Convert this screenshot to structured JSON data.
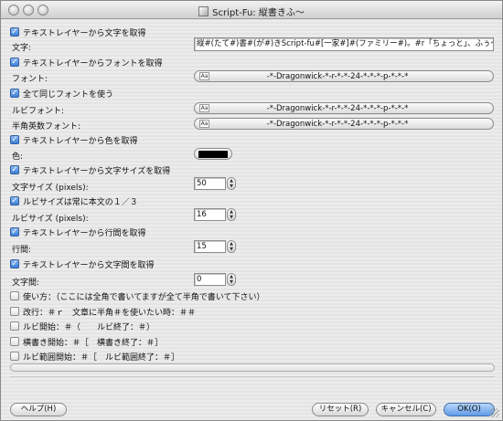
{
  "window": {
    "title": "Script-Fu: 縦書きふ〜"
  },
  "options": {
    "get_text_from_layer": {
      "label": "テキストレイヤーから文字を取得",
      "checked": true
    },
    "get_font_from_layer": {
      "label": "テキストレイヤーからフォントを取得",
      "checked": true
    },
    "use_same_font": {
      "label": "全て同じフォントを使う",
      "checked": true
    },
    "get_color_from_layer": {
      "label": "テキストレイヤーから色を取得",
      "checked": true
    },
    "get_size_from_layer": {
      "label": "テキストレイヤーから文字サイズを取得",
      "checked": true
    },
    "ruby_size_third": {
      "label": "ルビサイズは常に本文の１／３",
      "checked": true
    },
    "get_linespacing_from_layer": {
      "label": "テキストレイヤーから行間を取得",
      "checked": true
    },
    "get_letterspacing_from_layer": {
      "label": "テキストレイヤーから文字間を取得",
      "checked": true
    },
    "usage": {
      "label": "使い方：（ここには全角で書いてますが全て半角で書いて下さい）",
      "checked": false
    },
    "newline": {
      "label": "改行：＃ｒ　文章に半角＃を使いたい時：＃＃",
      "checked": false
    },
    "ruby_start": {
      "label": "ルビ開始：＃（　　ルビ終了：＃）",
      "checked": false
    },
    "yoko_start": {
      "label": "横書き開始：＃［　横書き終了：＃］",
      "checked": false
    },
    "ruby_range_start": {
      "label": "ルビ範囲開始：＃［　ルビ範囲終了：＃］",
      "checked": false
    }
  },
  "fields": {
    "text": {
      "label": "文字:",
      "value": "縦#(たて#)書#(が#)きScript-fu#[一家#]#(ファミリー#)。#r「ちょっと」、ふぅ〜#[!?#]"
    },
    "font": {
      "label": "フォント:",
      "value": "-*-Dragonwick-*-r-*-*-24-*-*-*-p-*-*-*",
      "icon_text": "Aa"
    },
    "ruby_font": {
      "label": "ルビフォント:",
      "value": "-*-Dragonwick-*-r-*-*-24-*-*-*-p-*-*-*",
      "icon_text": "Aa"
    },
    "halfwidth_font": {
      "label": "半角英数フォント:",
      "value": "-*-Dragonwick-*-r-*-*-24-*-*-*-p-*-*-*",
      "icon_text": "Aa"
    },
    "color": {
      "label": "色:",
      "value": "#000000"
    },
    "text_size": {
      "label": "文字サイズ (pixels):",
      "value": "50"
    },
    "ruby_size": {
      "label": "ルビサイズ (pixels):",
      "value": "16"
    },
    "line_spacing": {
      "label": "行間:",
      "value": "15"
    },
    "letter_spacing": {
      "label": "文字間:",
      "value": "0"
    }
  },
  "spin_arrows": {
    "up": "▲",
    "down": "▼"
  },
  "checkmark": "✓",
  "buttons": {
    "help": "ヘルプ(H)",
    "reset": "リセット(R)",
    "cancel": "キャンセル(C)",
    "ok": "OK(O)"
  }
}
